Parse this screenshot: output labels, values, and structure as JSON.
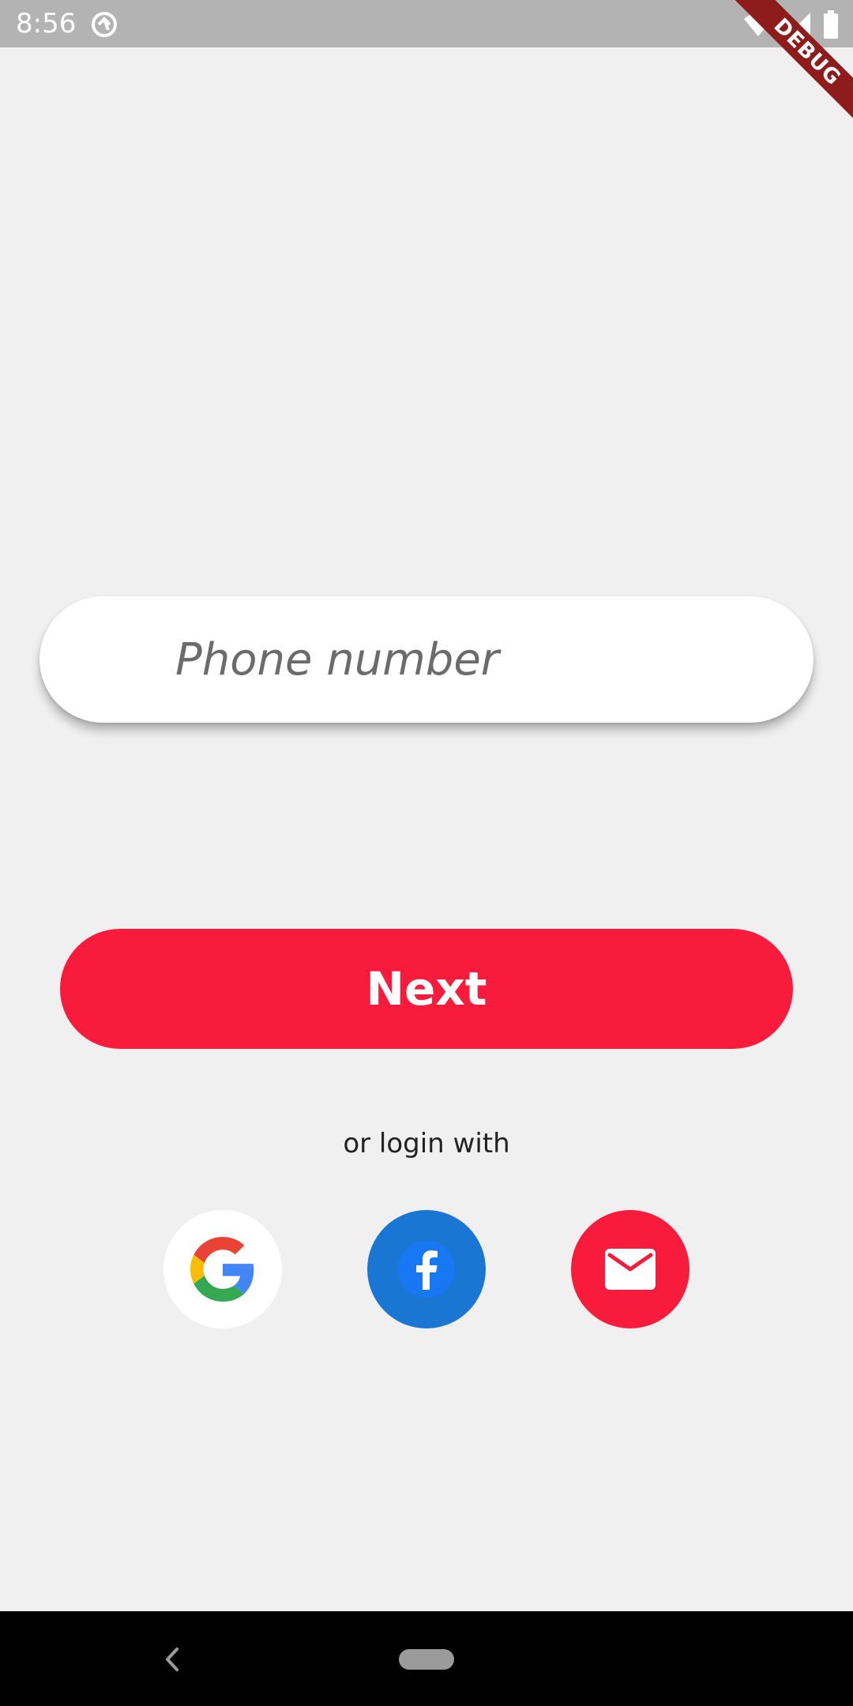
{
  "status_bar": {
    "time": "8:56",
    "icons": [
      "sync-icon",
      "wifi-icon",
      "signal-icon",
      "battery-icon"
    ]
  },
  "debug_banner": {
    "label": "DEBUG",
    "color": "#8e1c1c"
  },
  "login": {
    "phone_placeholder": "Phone number",
    "phone_value": "",
    "next_label": "Next",
    "or_login_label": "or login with"
  },
  "social": [
    {
      "name": "google",
      "icon": "google-icon",
      "background": "#ffffff"
    },
    {
      "name": "facebook",
      "icon": "facebook-icon",
      "background": "#1976d2"
    },
    {
      "name": "email",
      "icon": "mail-icon",
      "background": "#f91b3c"
    }
  ],
  "colors": {
    "accent": "#f91b3c",
    "background": "#f1f0f1",
    "status_bar": "#b3b3b3",
    "nav_bar": "#000000"
  },
  "nav_bar": {
    "icons": [
      "back-icon",
      "home-pill-icon"
    ]
  }
}
